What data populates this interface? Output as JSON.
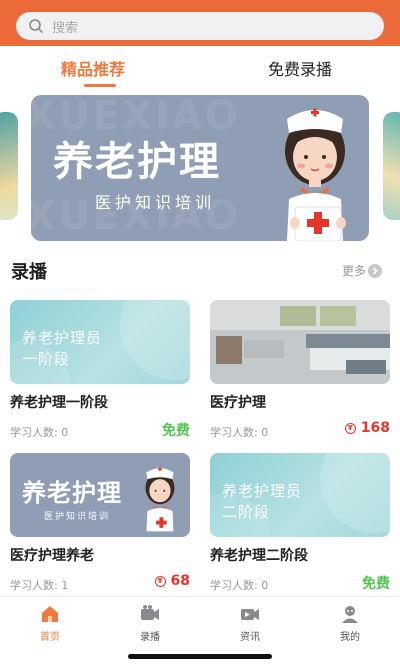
{
  "search": {
    "placeholder": "搜索"
  },
  "tabs": [
    {
      "label": "精品推荐"
    },
    {
      "label": "免费录播"
    }
  ],
  "banner": {
    "title": "养老护理",
    "subtitle": "医护知识培训",
    "watermark": "XUEXIAO"
  },
  "section": {
    "title": "录播",
    "more": "更多"
  },
  "courses": [
    {
      "thumb_text_line1": "养老护理员",
      "thumb_text_line2": "一阶段",
      "title": "养老护理一阶段",
      "learners": "学习人数: 0",
      "price": "免费"
    },
    {
      "title": "医疗护理",
      "learners": "学习人数: 0",
      "price": "168"
    },
    {
      "thumb_title": "养老护理",
      "thumb_sub": "医护知识培训",
      "title": "医疗护理养老",
      "learners": "学习人数: 1",
      "price": "68"
    },
    {
      "thumb_text_line1": "养老护理员",
      "thumb_text_line2": "二阶段",
      "title": "养老护理二阶段",
      "learners": "学习人数: 0",
      "price": "免费"
    }
  ],
  "bottom_nav": [
    {
      "label": "首页",
      "icon": "home-icon"
    },
    {
      "label": "录播",
      "icon": "video-icon"
    },
    {
      "label": "资讯",
      "icon": "news-icon"
    },
    {
      "label": "我的",
      "icon": "user-icon"
    }
  ],
  "colors": {
    "accent": "#ec6a3a",
    "free": "#4fc74f",
    "paid": "#e5352b"
  }
}
